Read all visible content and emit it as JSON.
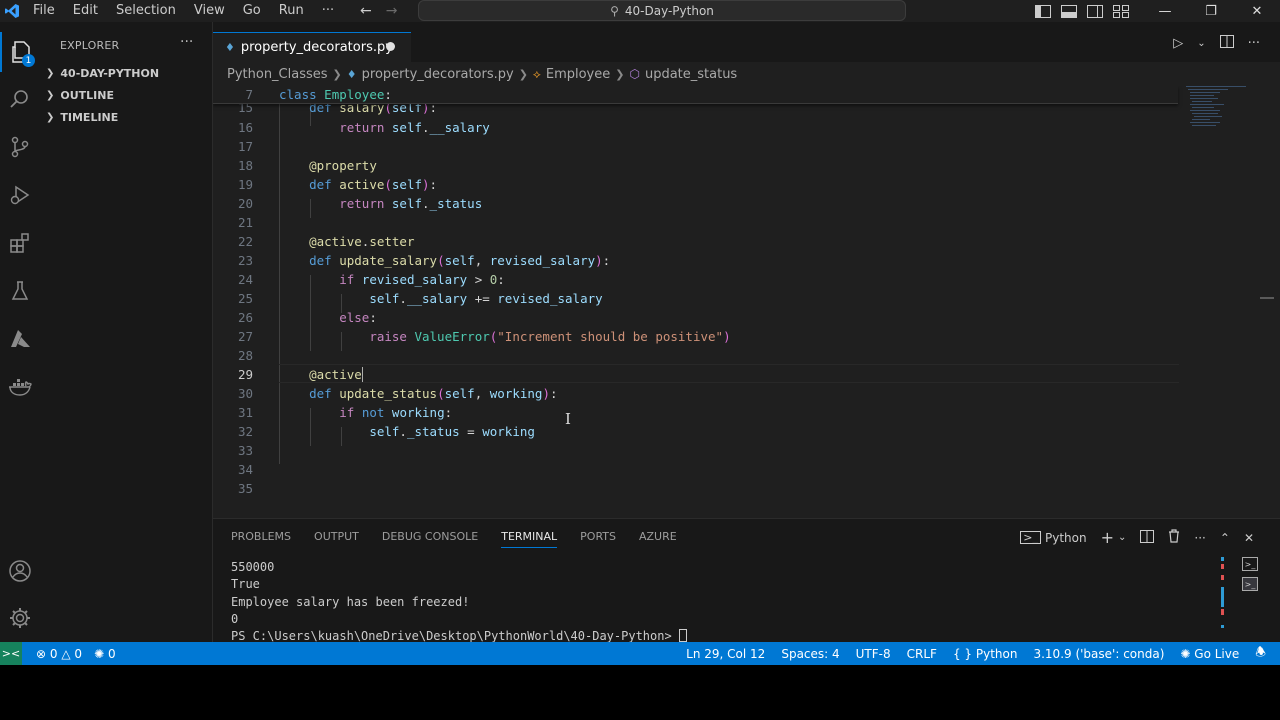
{
  "titlebar": {
    "menu": [
      "File",
      "Edit",
      "Selection",
      "View",
      "Go",
      "Run",
      "···"
    ],
    "search_text": "40-Day-Python"
  },
  "activitybar": {
    "items": [
      "explorer-icon",
      "search-icon",
      "source-control-icon",
      "run-debug-icon",
      "extensions-icon",
      "testing-icon",
      "azure-icon",
      "docker-icon",
      "accounts-icon",
      "settings-gear-icon"
    ],
    "explorer_badge": "1"
  },
  "sidebar": {
    "title": "EXPLORER",
    "more": "···",
    "sections": [
      "40-DAY-PYTHON",
      "OUTLINE",
      "TIMELINE"
    ]
  },
  "tab": {
    "label": "property_decorators.py"
  },
  "breadcrumb": {
    "folder": "Python_Classes",
    "file": "property_decorators.py",
    "class": "Employee",
    "method": "update_status"
  },
  "editor": {
    "sticky_line_no": "7",
    "lines": [
      "15",
      "16",
      "17",
      "18",
      "19",
      "20",
      "21",
      "22",
      "23",
      "24",
      "25",
      "26",
      "27",
      "28",
      "29",
      "30",
      "31",
      "32",
      "33",
      "34",
      "35"
    ],
    "current_line": "29"
  },
  "panel": {
    "tabs": [
      "PROBLEMS",
      "OUTPUT",
      "DEBUG CONSOLE",
      "TERMINAL",
      "PORTS",
      "AZURE"
    ],
    "active_tab": "TERMINAL",
    "terminal_profile": "Python",
    "terminal_lines": [
      "550000",
      "True",
      "Employee salary has been freezed!",
      "0",
      "PS C:\\Users\\kuash\\OneDrive\\Desktop\\PythonWorld\\40-Day-Python> "
    ]
  },
  "statusbar": {
    "errors": "0",
    "warnings": "0",
    "ports": "0",
    "position": "Ln 29, Col 12",
    "spaces": "Spaces: 4",
    "encoding": "UTF-8",
    "eol": "CRLF",
    "language": "Python",
    "interpreter": "3.10.9 ('base': conda)",
    "golive": "Go Live"
  },
  "colors": {
    "accent": "#0078d4",
    "remote": "#16825d",
    "editor_bg": "#1f1f1f",
    "sidebar_bg": "#181818"
  }
}
